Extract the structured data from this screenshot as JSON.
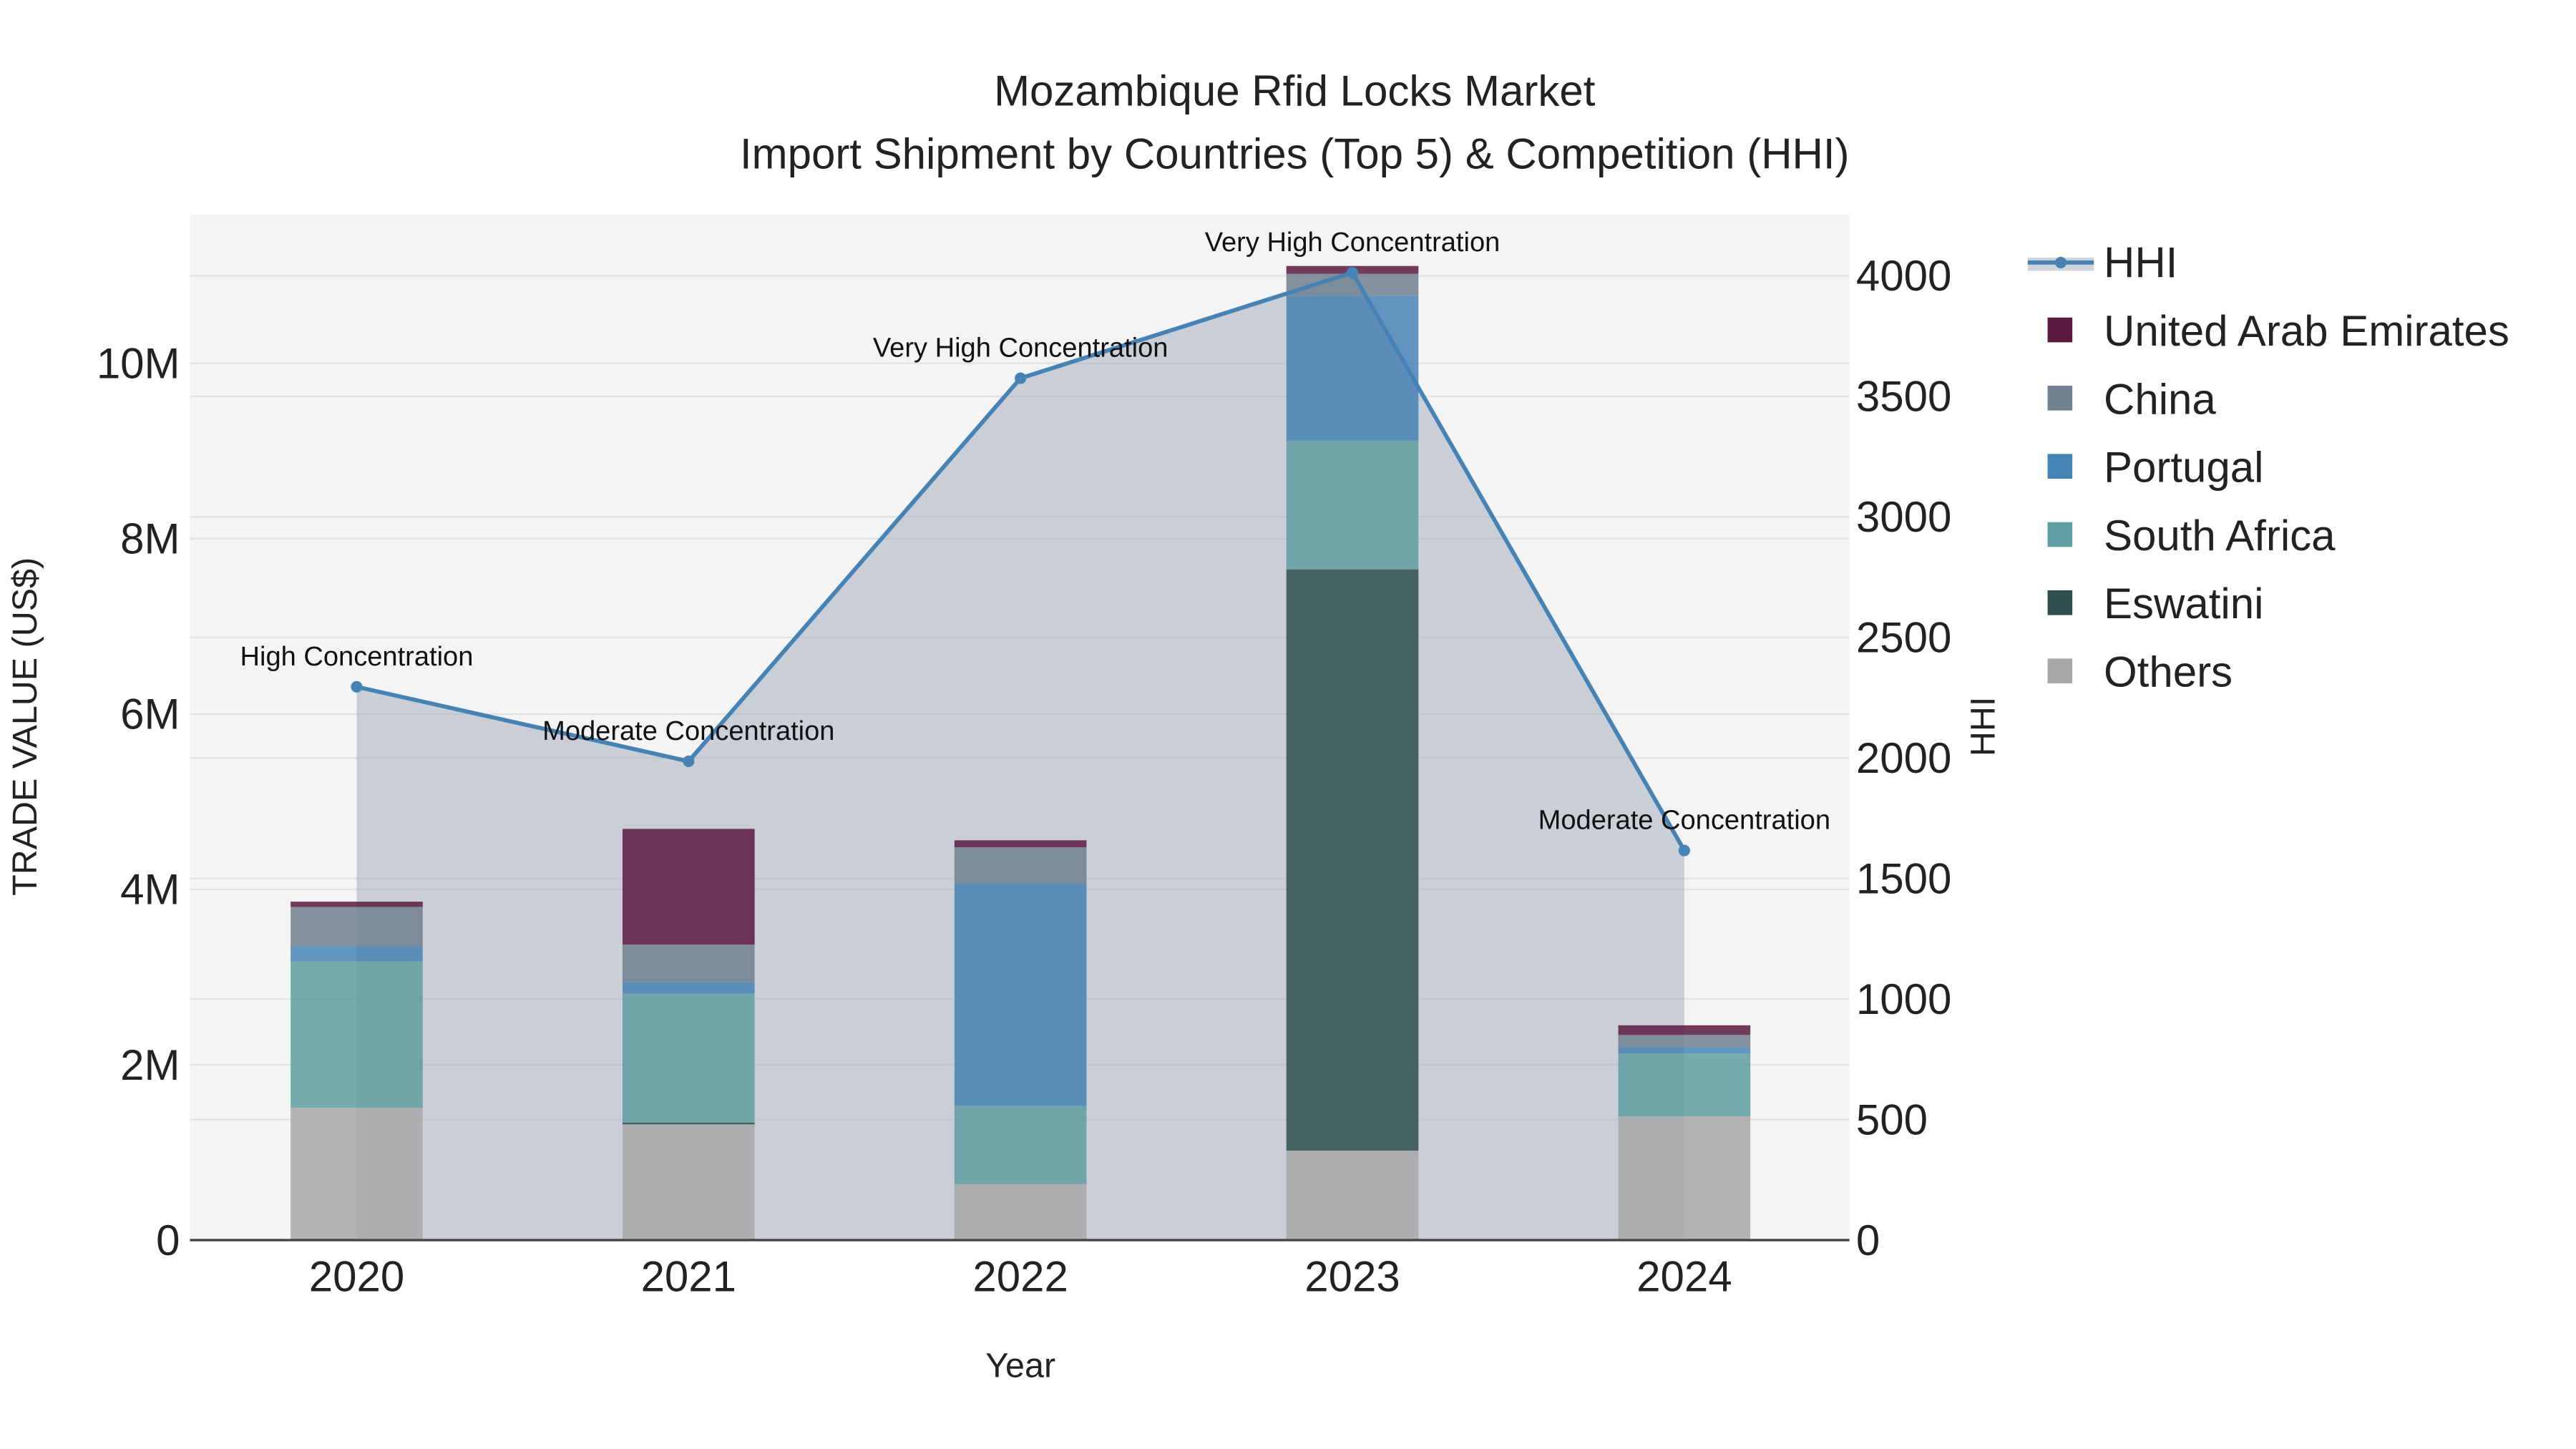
{
  "chart_data": {
    "type": "bar",
    "title": "Mozambique Rfid Locks Market",
    "subtitle": "Import Shipment by Countries (Top 5) & Competition (HHI)",
    "xlabel": "Year",
    "ylabel": "TRADE VALUE (US$)",
    "y2label": "HHI",
    "categories": [
      "2020",
      "2021",
      "2022",
      "2023",
      "2024"
    ],
    "ylim": [
      0,
      11700000
    ],
    "y2lim": [
      0,
      4250
    ],
    "yticks": [
      {
        "v": 0,
        "label": "0"
      },
      {
        "v": 2000000,
        "label": "2M"
      },
      {
        "v": 4000000,
        "label": "4M"
      },
      {
        "v": 6000000,
        "label": "6M"
      },
      {
        "v": 8000000,
        "label": "8M"
      },
      {
        "v": 10000000,
        "label": "10M"
      }
    ],
    "y2ticks": [
      0,
      500,
      1000,
      1500,
      2000,
      2500,
      3000,
      3500,
      4000
    ],
    "series": [
      {
        "name": "Others",
        "color": "#a8a8a8",
        "values": [
          1510000,
          1320000,
          640000,
          1020000,
          1410000
        ]
      },
      {
        "name": "Eswatini",
        "color": "#2f4f4f",
        "values": [
          0,
          20000,
          0,
          6630000,
          0
        ]
      },
      {
        "name": "South Africa",
        "color": "#5f9ea0",
        "values": [
          1670000,
          1470000,
          890000,
          1470000,
          720000
        ]
      },
      {
        "name": "Portugal",
        "color": "#4682b4",
        "values": [
          170000,
          130000,
          2540000,
          1650000,
          70000
        ]
      },
      {
        "name": "China",
        "color": "#708090",
        "values": [
          450000,
          430000,
          410000,
          250000,
          140000
        ]
      },
      {
        "name": "United Arab Emirates",
        "color": "#5c1a3e",
        "values": [
          60000,
          1320000,
          80000,
          90000,
          110000
        ]
      }
    ],
    "hhi": {
      "name": "HHI",
      "color": "#4682b4",
      "values": [
        2295,
        1986,
        3575,
        4013,
        1616
      ],
      "annotations": [
        "High Concentration",
        "Moderate Concentration",
        "Very High Concentration",
        "Very High Concentration",
        "Moderate Concentration"
      ]
    },
    "legend_order": [
      "HHI",
      "United Arab Emirates",
      "China",
      "Portugal",
      "South Africa",
      "Eswatini",
      "Others"
    ],
    "legend_placement": "right",
    "grid": true
  }
}
